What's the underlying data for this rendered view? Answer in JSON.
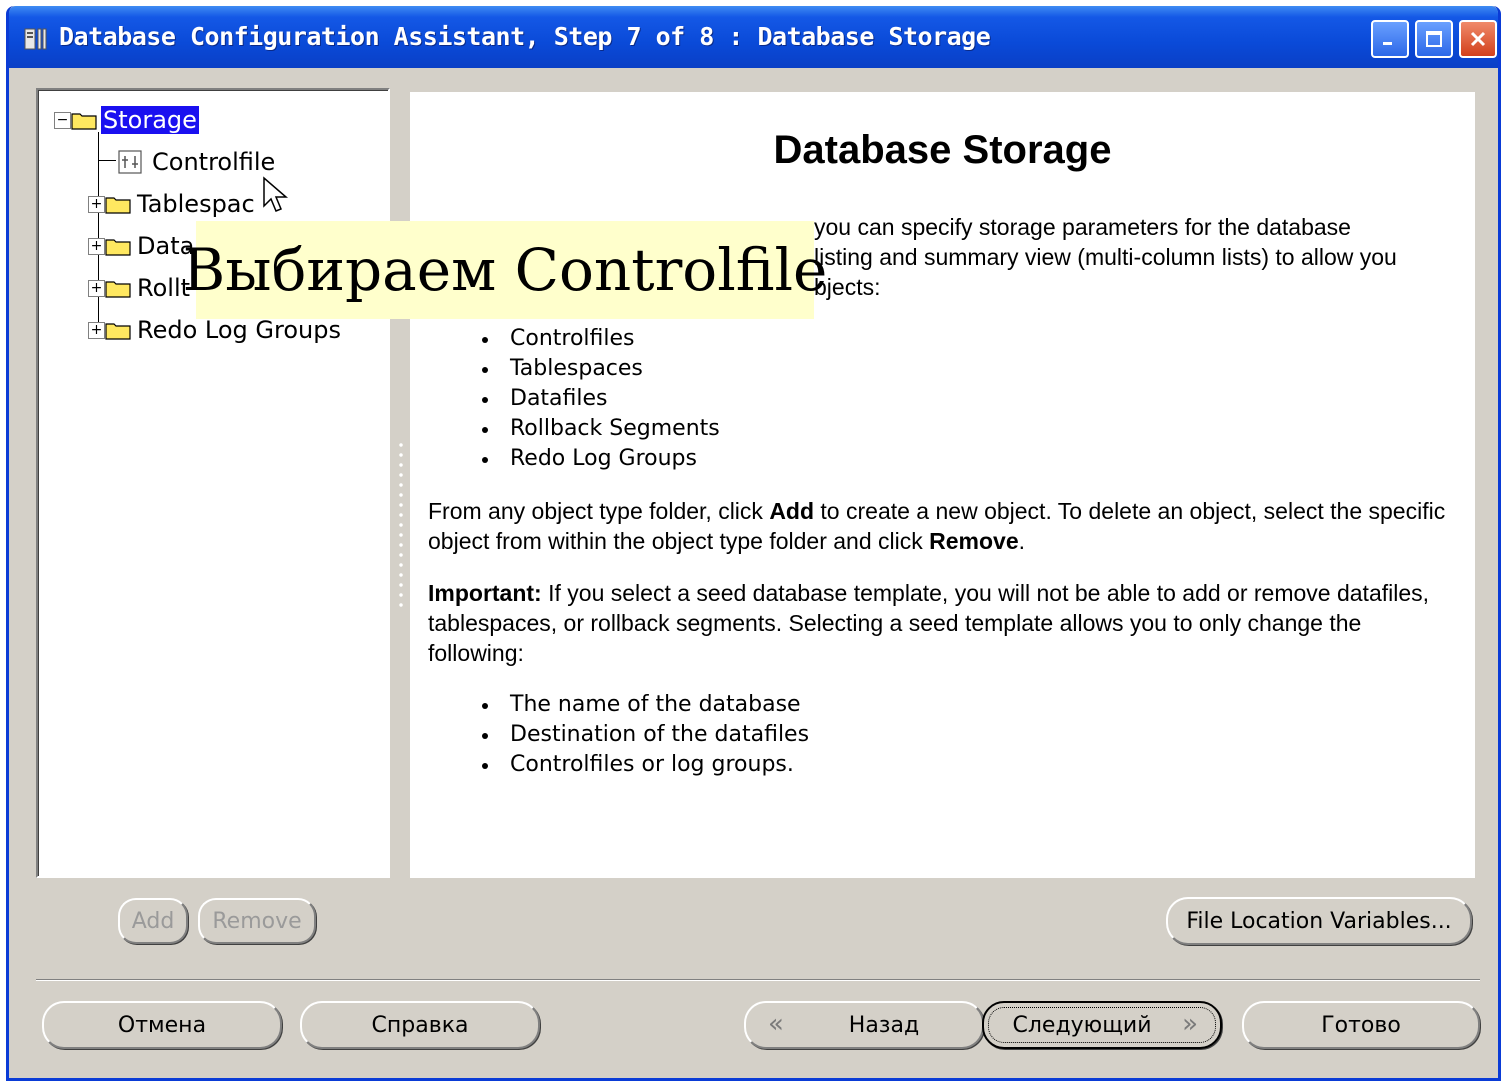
{
  "window": {
    "title": "Database Configuration Assistant, Step 7 of 8 : Database Storage"
  },
  "tree": {
    "root": "Storage",
    "items": [
      {
        "label": "Controlfile"
      },
      {
        "label": "Tablespaces"
      },
      {
        "label": "Datafiles"
      },
      {
        "label": "Rollback Segments"
      },
      {
        "label": "Redo Log Groups"
      }
    ],
    "visible_labels": [
      "Controlfile",
      "Tablespac",
      "Data",
      "Rollt",
      "Redo Log Groups"
    ]
  },
  "content": {
    "title": "Database Storage",
    "intro_fragment_1": "you can specify storage parameters for the database",
    "intro_fragment_2": "listing and summary view (multi-column lists) to allow you",
    "intro_fragment_3": "bjects:",
    "object_list": [
      "Controlfiles",
      "Tablespaces",
      "Datafiles",
      "Rollback Segments",
      "Redo Log Groups"
    ],
    "para2_a": "From any object type folder, click ",
    "para2_add": "Add",
    "para2_b": " to create a new object. To delete an object, select the specific object from within the object type folder and click ",
    "para2_remove": "Remove",
    "para2_c": ".",
    "para3_label": "Important:",
    "para3_text": " If you select a seed database template, you will not be able to add or remove datafiles, tablespaces, or rollback segments. Selecting a seed template allows you to only change the following:",
    "change_list": [
      "The name of the database",
      "Destination of the datafiles",
      "Controlfiles or log groups."
    ]
  },
  "overlay": {
    "text": "Выбираем Controlfile"
  },
  "buttons": {
    "add": "Add",
    "remove": "Remove",
    "file_location_variables": "File Location Variables...",
    "cancel": "Отмена",
    "help": "Справка",
    "back": "Назад",
    "next": "Следующий",
    "finish": "Готово"
  },
  "icons": {
    "title": "app-icon",
    "controlfile": "controlfile-icon",
    "folder": "folder-icon",
    "back": "chevron-left-icon",
    "next": "chevron-right-icon",
    "cursor": "mouse-cursor-icon"
  },
  "colors": {
    "titlebar": "#0a4ad8",
    "selection": "#1a10f0",
    "callout": "#ffffcc",
    "dialog": "#d4d0c8"
  }
}
